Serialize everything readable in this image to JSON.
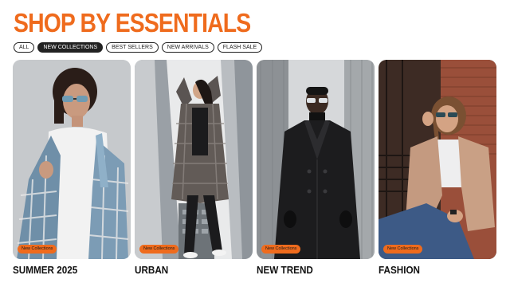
{
  "header": {
    "title": "SHOP BY ESSENTIALS"
  },
  "filters": [
    {
      "label": "ALL",
      "active": false
    },
    {
      "label": "NEW COLLECTIONS",
      "active": true
    },
    {
      "label": "BEST SELLERS",
      "active": false
    },
    {
      "label": "NEW ARRIVALS",
      "active": false
    },
    {
      "label": "FLASH SALE",
      "active": false
    }
  ],
  "cards": [
    {
      "label": "SUMMER 2025",
      "badge": "New Collections",
      "photo": "woman-plaid-shirt-sunglasses-photo"
    },
    {
      "label": "URBAN",
      "badge": "New Collections",
      "photo": "woman-plaid-coat-street-photo"
    },
    {
      "label": "NEW TREND",
      "badge": "New Collections",
      "photo": "man-black-coat-photo"
    },
    {
      "label": "FASHION",
      "badge": "New Collections",
      "photo": "woman-beige-blazer-brick-wall-photo"
    }
  ],
  "colors": {
    "accent": "#ef6b1d",
    "text": "#111111",
    "chip_active_bg": "#222222"
  }
}
